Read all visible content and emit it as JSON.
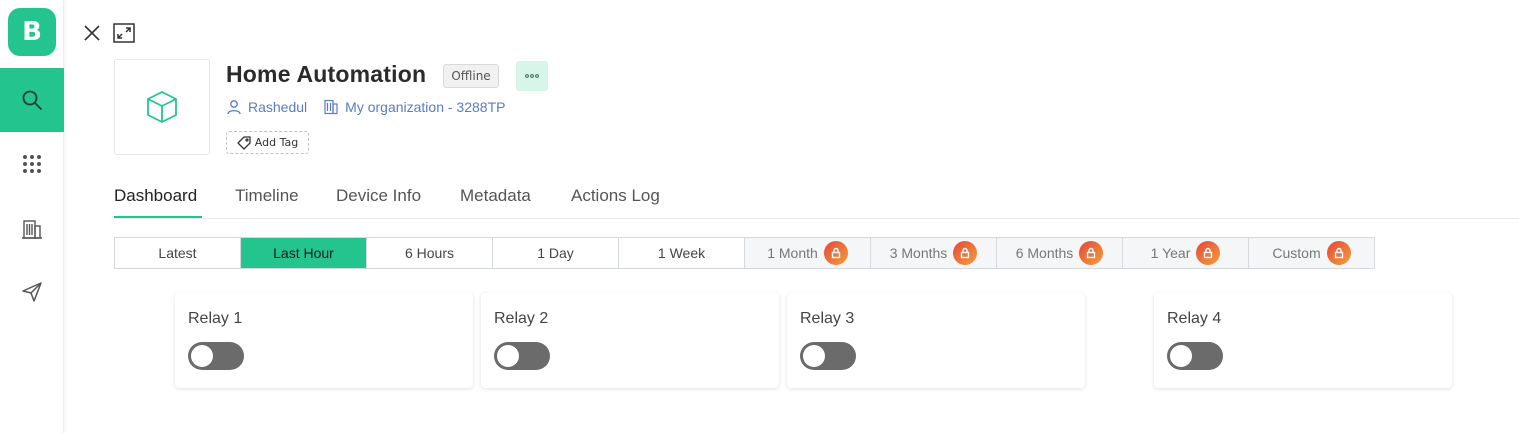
{
  "app": {
    "logo_letter": "B"
  },
  "sidebar": {
    "items": [
      {
        "icon": "search-icon",
        "active": true
      },
      {
        "icon": "grid-icon",
        "active": false
      },
      {
        "icon": "organization-icon",
        "active": false
      },
      {
        "icon": "send-icon",
        "active": false
      }
    ]
  },
  "device": {
    "title": "Home Automation",
    "status": "Offline",
    "owner": "Rashedul",
    "organization": "My organization - 3288TP",
    "add_tag_label": "Add Tag"
  },
  "tabs": [
    {
      "label": "Dashboard",
      "active": true
    },
    {
      "label": "Timeline",
      "active": false
    },
    {
      "label": "Device Info",
      "active": false
    },
    {
      "label": "Metadata",
      "active": false
    },
    {
      "label": "Actions Log",
      "active": false
    }
  ],
  "time_range": [
    {
      "label": "Latest",
      "active": false,
      "locked": false
    },
    {
      "label": "Last Hour",
      "active": true,
      "locked": false
    },
    {
      "label": "6 Hours",
      "active": false,
      "locked": false
    },
    {
      "label": "1 Day",
      "active": false,
      "locked": false
    },
    {
      "label": "1 Week",
      "active": false,
      "locked": false
    },
    {
      "label": "1 Month",
      "active": false,
      "locked": true
    },
    {
      "label": "3 Months",
      "active": false,
      "locked": true
    },
    {
      "label": "6 Months",
      "active": false,
      "locked": true
    },
    {
      "label": "1 Year",
      "active": false,
      "locked": true
    },
    {
      "label": "Custom",
      "active": false,
      "locked": true
    }
  ],
  "widgets": [
    {
      "title": "Relay 1",
      "on": false
    },
    {
      "title": "Relay 2",
      "on": false
    },
    {
      "title": "Relay 3",
      "on": false
    },
    {
      "title": "Relay 4",
      "on": false
    }
  ],
  "colors": {
    "accent": "#23c48e",
    "link": "#5b7bc8",
    "toggle_off": "#6b6b6b",
    "lock_gradient_start": "#e8453c",
    "lock_gradient_end": "#f0a13a"
  }
}
